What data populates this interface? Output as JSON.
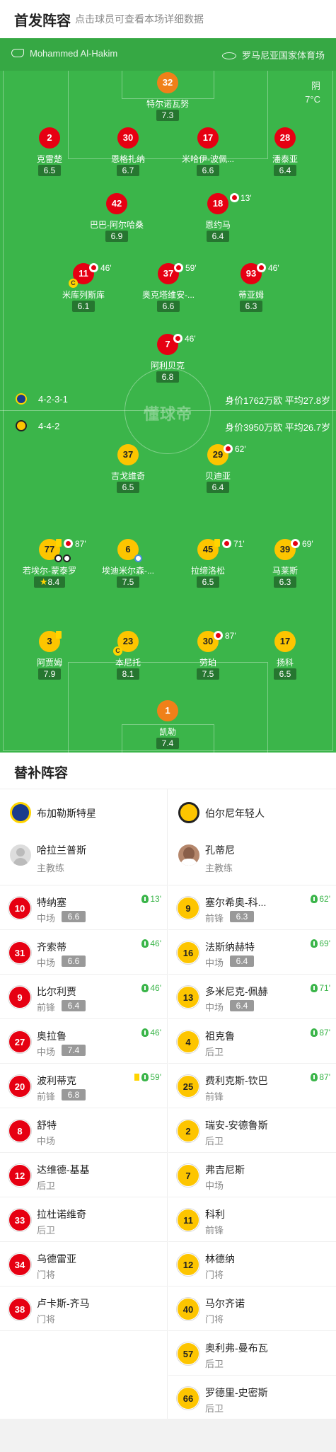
{
  "header": {
    "title": "首发阵容",
    "subtitle": "点击球员可查看本场详细数据"
  },
  "pitch_info": {
    "referee": "Mohammed Al-Hakim",
    "venue": "罗马尼亚国家体育场",
    "weather": "阴",
    "temperature": "7°C",
    "watermark": "懂球帝"
  },
  "home": {
    "formation": "4-2-3-1",
    "valuation": "身价1762万欧 平均27.8岁",
    "color": "#e60012",
    "players": [
      {
        "num": "2",
        "name": "克雷楚",
        "rating": "6.5"
      },
      {
        "num": "30",
        "name": "恩格扎纳",
        "rating": "6.7"
      },
      {
        "num": "17",
        "name": "米哈伊-波佩...",
        "rating": "6.6"
      },
      {
        "num": "28",
        "name": "潘泰亚",
        "rating": "6.4"
      },
      {
        "num": "42",
        "name": "巴巴-阿尔哈桑",
        "rating": "6.9"
      },
      {
        "num": "18",
        "name": "恩约马",
        "rating": "6.4",
        "sub_minute": "13'"
      },
      {
        "num": "11",
        "name": "米库列斯库",
        "rating": "6.1",
        "sub_minute": "46'"
      },
      {
        "num": "37",
        "name": "奥克塔维安-...",
        "rating": "6.6",
        "sub_minute": "59'"
      },
      {
        "num": "93",
        "name": "蒂亚姆",
        "rating": "6.3",
        "sub_minute": "46'"
      },
      {
        "num": "7",
        "name": "阿利贝克",
        "rating": "6.8",
        "sub_minute": "46'"
      }
    ],
    "goalkeeper": {
      "num": "32",
      "name": "特尔诺瓦努",
      "rating": "7.3"
    }
  },
  "away": {
    "formation": "4-4-2",
    "valuation": "身价3950万欧 平均26.7岁",
    "color": "#fdc500",
    "players": [
      {
        "num": "37",
        "name": "吉戈维奇",
        "rating": "6.5"
      },
      {
        "num": "29",
        "name": "贝迪亚",
        "rating": "6.4",
        "sub_minute": "62'"
      },
      {
        "num": "77",
        "name": "若埃尔-蒙泰罗",
        "rating": "8.4",
        "sub_minute": "87'"
      },
      {
        "num": "6",
        "name": "埃迪米尔森-...",
        "rating": "7.5"
      },
      {
        "num": "45",
        "name": "拉缔洛松",
        "rating": "6.5",
        "sub_minute": "71'"
      },
      {
        "num": "39",
        "name": "马莱斯",
        "rating": "6.3",
        "sub_minute": "69'"
      },
      {
        "num": "3",
        "name": "阿贾姆",
        "rating": "7.9"
      },
      {
        "num": "23",
        "name": "本尼托",
        "rating": "8.1"
      },
      {
        "num": "30",
        "name": "劳珀",
        "rating": "7.5",
        "sub_minute": "87'"
      },
      {
        "num": "17",
        "name": "扬科",
        "rating": "6.5"
      }
    ],
    "goalkeeper": {
      "num": "1",
      "name": "凯勒",
      "rating": "7.4"
    }
  },
  "subs_section": {
    "title": "替补阵容",
    "home": {
      "team_name": "布加勒斯特星",
      "coach_name": "哈拉兰普斯",
      "coach_role": "主教练",
      "subs": [
        {
          "num": "10",
          "name": "特纳塞",
          "pos": "中场",
          "rating": "6.6",
          "in": "13'"
        },
        {
          "num": "31",
          "name": "齐索蒂",
          "pos": "中场",
          "rating": "6.6",
          "in": "46'"
        },
        {
          "num": "9",
          "name": "比尔利贾",
          "pos": "前锋",
          "rating": "6.4",
          "in": "46'"
        },
        {
          "num": "27",
          "name": "奥拉鲁",
          "pos": "中场",
          "rating": "7.4",
          "in": "46'"
        },
        {
          "num": "20",
          "name": "波利蒂克",
          "pos": "前锋",
          "rating": "6.8",
          "in": "59'"
        },
        {
          "num": "8",
          "name": "舒特",
          "pos": "中场"
        },
        {
          "num": "12",
          "name": "达维德-基基",
          "pos": "后卫"
        },
        {
          "num": "33",
          "name": "拉杜诺维奇",
          "pos": "后卫"
        },
        {
          "num": "34",
          "name": "乌德雷亚",
          "pos": "门将"
        },
        {
          "num": "38",
          "name": "卢卡斯-齐马",
          "pos": "门将"
        }
      ]
    },
    "away": {
      "team_name": "伯尔尼年轻人",
      "coach_name": "孔蒂尼",
      "coach_role": "主教练",
      "subs": [
        {
          "num": "9",
          "name": "塞尔希奥-科...",
          "pos": "前锋",
          "rating": "6.3",
          "in": "62'"
        },
        {
          "num": "16",
          "name": "法斯纳赫特",
          "pos": "中场",
          "rating": "6.4",
          "in": "69'"
        },
        {
          "num": "13",
          "name": "多米尼克-佩赫",
          "pos": "中场",
          "rating": "6.4",
          "in": "71'"
        },
        {
          "num": "4",
          "name": "祖克鲁",
          "pos": "后卫",
          "in": "87'"
        },
        {
          "num": "25",
          "name": "费利克斯-钦巴",
          "pos": "前锋",
          "in": "87'"
        },
        {
          "num": "2",
          "name": "瑞安-安德鲁斯",
          "pos": "后卫"
        },
        {
          "num": "7",
          "name": "弗吉尼斯",
          "pos": "中场"
        },
        {
          "num": "11",
          "name": "科利",
          "pos": "前锋"
        },
        {
          "num": "12",
          "name": "林德纳",
          "pos": "门将"
        },
        {
          "num": "40",
          "name": "马尔齐诺",
          "pos": "门将"
        },
        {
          "num": "57",
          "name": "奥利弗-曼布瓦",
          "pos": "后卫"
        },
        {
          "num": "66",
          "name": "罗德里-史密斯",
          "pos": "后卫"
        }
      ]
    }
  }
}
